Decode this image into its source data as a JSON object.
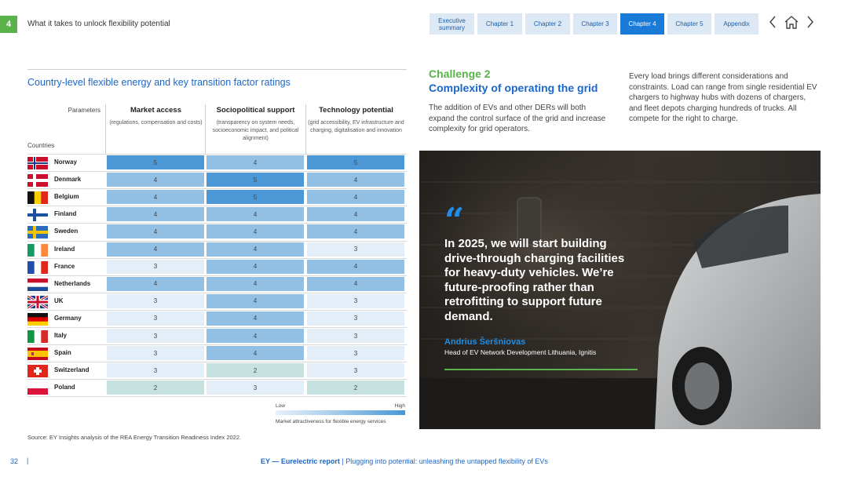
{
  "header": {
    "page_number": "4",
    "section_title": "What it takes to unlock flexibility potential",
    "tabs": [
      {
        "label": "Executive summary",
        "active": false
      },
      {
        "label": "Chapter 1",
        "active": false
      },
      {
        "label": "Chapter 2",
        "active": false
      },
      {
        "label": "Chapter 3",
        "active": false
      },
      {
        "label": "Chapter 4",
        "active": true
      },
      {
        "label": "Chapter 5",
        "active": false
      },
      {
        "label": "Appendix",
        "active": false
      }
    ],
    "icons": [
      "chevron-left-icon",
      "home-icon",
      "chevron-right-icon"
    ]
  },
  "table": {
    "title": "Country-level flexible energy and key transition factor ratings",
    "parameters_label": "Parameters",
    "countries_label": "Countries",
    "columns": [
      {
        "title": "Market access",
        "desc": "(regulations, compensation and costs)"
      },
      {
        "title": "Sociopolitical support",
        "desc": "(transparency on system needs, socioeconomic impact, and political alignment)"
      },
      {
        "title": "Technology potential",
        "desc": "(grid accessibility, EV infrastructure and charging, digitalisation and innovation"
      }
    ],
    "rows": [
      {
        "country": "Norway",
        "flag": "norway",
        "values": [
          "5",
          "4",
          "5"
        ]
      },
      {
        "country": "Denmark",
        "flag": "denmark",
        "values": [
          "4",
          "5",
          "4"
        ]
      },
      {
        "country": "Belgium",
        "flag": "belgium",
        "values": [
          "4",
          "5",
          "4"
        ]
      },
      {
        "country": "Finland",
        "flag": "finland",
        "values": [
          "4",
          "4",
          "4"
        ]
      },
      {
        "country": "Sweden",
        "flag": "sweden",
        "values": [
          "4",
          "4",
          "4"
        ]
      },
      {
        "country": "Ireland",
        "flag": "ireland",
        "values": [
          "4",
          "4",
          "3"
        ]
      },
      {
        "country": "France",
        "flag": "france",
        "values": [
          "3",
          "4",
          "4"
        ]
      },
      {
        "country": "Netherlands",
        "flag": "netherlands",
        "values": [
          "4",
          "4",
          "4"
        ]
      },
      {
        "country": "UK",
        "flag": "uk",
        "values": [
          "3",
          "4",
          "3"
        ]
      },
      {
        "country": "Germany",
        "flag": "germany",
        "values": [
          "3",
          "4",
          "3"
        ]
      },
      {
        "country": "Italy",
        "flag": "italy",
        "values": [
          "3",
          "4",
          "3"
        ]
      },
      {
        "country": "Spain",
        "flag": "spain",
        "values": [
          "3",
          "4",
          "3"
        ]
      },
      {
        "country": "Switzerland",
        "flag": "switzerland",
        "values": [
          "3",
          "2",
          "3"
        ]
      },
      {
        "country": "Poland",
        "flag": "poland",
        "values": [
          "2",
          "3",
          "2"
        ]
      }
    ],
    "rating_colors": {
      "2": "#c6e2e0",
      "3": "#e4eef8",
      "4": "#92c0e5",
      "5": "#4c98d6"
    },
    "legend": {
      "low": "Low",
      "high": "High",
      "caption": "Market attractiveness for flexible energy services"
    },
    "source": "Source: EY Insights analysis of the REA Energy Transition Readiness Index 2022."
  },
  "challenge": {
    "label": "Challenge 2",
    "title": "Complexity of operating the grid",
    "body": "The addition of EVs and other DERs will both expand the control surface of the grid and increase complexity for grid operators.",
    "body2": "Every load brings different considerations and constraints. Load can range from single residential EV chargers to highway hubs with dozens of chargers, and fleet depots charging hundreds of trucks. All compete for the right to charge."
  },
  "quote": {
    "mark": "“",
    "text": "In 2025, we will start building drive-through charging facilities for heavy-duty vehicles. We’re future-proofing rather than retrofitting to support future demand.",
    "author": "Andrius Šeršniovas",
    "role": "Head of EV Network Development Lithuania, Ignitis"
  },
  "footer": {
    "page": "32",
    "separator": "|",
    "report": "EY — Eurelectric report",
    "title": "| Plugging into potential: unleashing the untapped flexibility of EVs"
  },
  "colors": {
    "brand_blue": "#1b66c9",
    "brand_green": "#59b34a",
    "active_tab": "#1a7ad8"
  }
}
